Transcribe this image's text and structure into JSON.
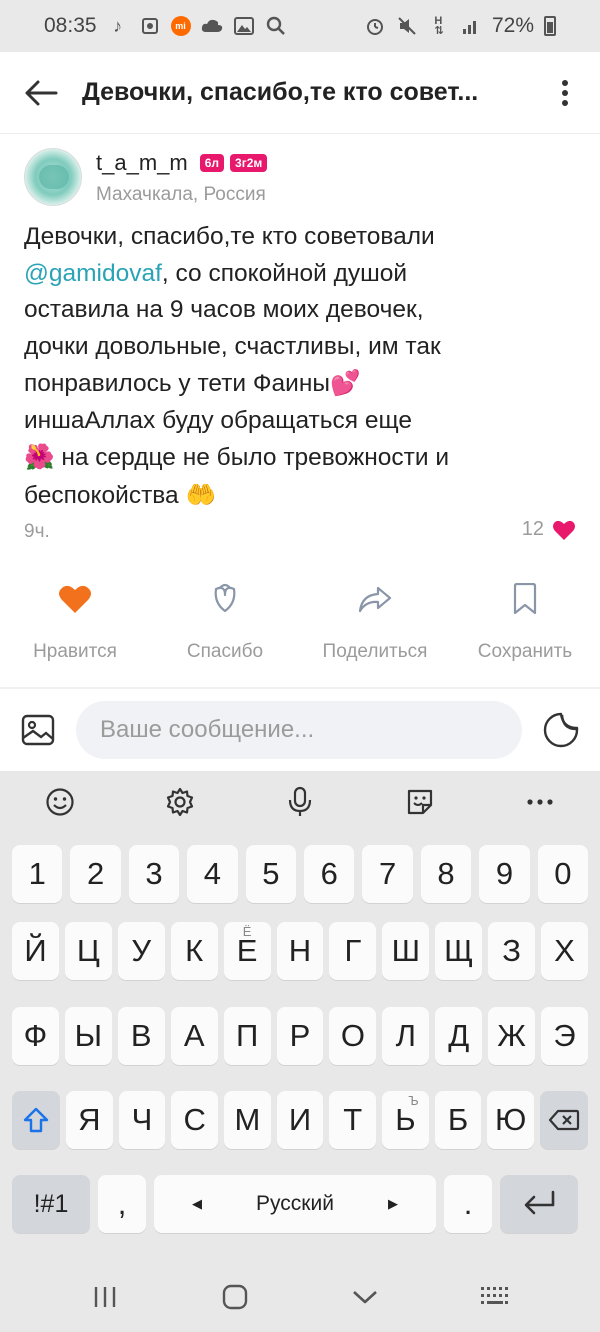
{
  "status_bar": {
    "time": "08:35",
    "battery": "72%",
    "icons_left": [
      "music-note-icon",
      "photo-frame-icon",
      "mi-icon",
      "cloud-icon",
      "gallery-icon",
      "search-icon"
    ],
    "icons_right": [
      "alarm-icon",
      "mute-icon",
      "network-icon",
      "signal-icon",
      "battery-icon"
    ]
  },
  "header": {
    "title": "Девочки, спасибо,те кто совет..."
  },
  "post": {
    "author": {
      "username": "t_a_m_m",
      "badges": [
        "6л",
        "3г2м"
      ],
      "location": "Махачкала, Россия"
    },
    "text": {
      "line1": "Девочки, спасибо,те кто советовали",
      "mention": "@gamidovaf",
      "line2_rest": ", со спокойной душой",
      "line3": "оставила на 9 часов моих девочек,",
      "line4": "дочки довольные, счастливы, им так",
      "line5": "понравилось  у тети Фаины",
      "emoji_hearts": "💕",
      "line6": "иншаАллах буду обращаться еще",
      "emoji_flower": "🌺",
      "line7": " на сердце не было тревожности и",
      "line8": "беспокойства ",
      "emoji_hands": "🤲"
    },
    "time": "9ч.",
    "like_count": "12",
    "accent_color": "#e8196c"
  },
  "actions": [
    {
      "label": "Нравится",
      "icon": "heart-filled-icon",
      "active": true
    },
    {
      "label": "Спасибо",
      "icon": "flower-icon"
    },
    {
      "label": "Поделиться",
      "icon": "share-icon"
    },
    {
      "label": "Сохранить",
      "icon": "bookmark-icon"
    }
  ],
  "composer": {
    "placeholder": "Ваше сообщение...",
    "value": ""
  },
  "keyboard": {
    "toolbar": [
      "emoji-icon",
      "settings-icon",
      "microphone-icon",
      "sticker-icon",
      "more-icon"
    ],
    "row_numbers": [
      "1",
      "2",
      "3",
      "4",
      "5",
      "6",
      "7",
      "8",
      "9",
      "0"
    ],
    "row1": [
      "Й",
      "Ц",
      "У",
      "К",
      "Е",
      "Н",
      "Г",
      "Ш",
      "Щ",
      "З",
      "Х"
    ],
    "row1_e_sup": "Ё",
    "row2": [
      "Ф",
      "Ы",
      "В",
      "А",
      "П",
      "Р",
      "О",
      "Л",
      "Д",
      "Ж",
      "Э"
    ],
    "row3": [
      "Я",
      "Ч",
      "С",
      "М",
      "И",
      "Т",
      "Ь",
      "Б",
      "Ю"
    ],
    "row3_soft_sup": "Ъ",
    "sym_label": "!#1",
    "comma": ",",
    "space_label": "Русский",
    "dot": "."
  },
  "navbar": [
    "recents-icon",
    "home-icon",
    "back-chevron-icon",
    "keyboard-grid-icon"
  ]
}
